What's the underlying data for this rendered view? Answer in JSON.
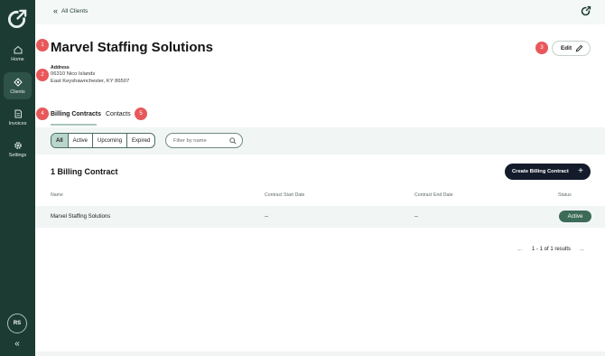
{
  "sidebar": {
    "logo_icon": "brand-logo-icon",
    "items": [
      {
        "label": "Home",
        "icon": "home-icon"
      },
      {
        "label": "Clients",
        "icon": "clients-icon",
        "active": true
      },
      {
        "label": "Invoices",
        "icon": "invoice-icon"
      },
      {
        "label": "Settings",
        "icon": "gear-icon"
      }
    ],
    "avatar_initials": "RS",
    "collapse_glyph": "«"
  },
  "topbar": {
    "back_label": "All Clients",
    "back_glyph": "«",
    "account_icon": "account-icon"
  },
  "header": {
    "title": "Marvel Staffing Solutions",
    "address_label": "Address",
    "address_line1": "06310 Nico Islands",
    "address_line2": "East Keyshawnchester, KY 86507",
    "edit_label": "Edit",
    "markers": [
      "1",
      "2",
      "3",
      "4",
      "5"
    ]
  },
  "tabs": [
    {
      "label": "Billing Contracts",
      "active": true
    },
    {
      "label": "Contacts",
      "active": false
    }
  ],
  "filters": {
    "segments": [
      {
        "label": "All",
        "active": true
      },
      {
        "label": "Active",
        "active": false
      },
      {
        "label": "Upcoming",
        "active": false
      },
      {
        "label": "Expired",
        "active": false
      }
    ],
    "search_placeholder": "Filter by name"
  },
  "contracts": {
    "heading": "1 Billing Contract",
    "create_label": "Create Billing Contract",
    "create_glyph": "+",
    "columns": [
      "Name",
      "Contract Start Date",
      "Contract End Date",
      "Status"
    ],
    "rows": [
      {
        "name": "Marvel Staffing Solutions",
        "start": "--",
        "end": "--",
        "status": "Active"
      }
    ]
  },
  "pagination": {
    "summary": "1 - 1 of 1 results",
    "prev_glyph": "←",
    "next_glyph": "→"
  },
  "colors": {
    "sidebar": "#1c3b33",
    "marker": "#e8585a",
    "primary_button": "#141b2b",
    "status_active": "#3c6b58",
    "segment_active": "#b9d6cc"
  }
}
